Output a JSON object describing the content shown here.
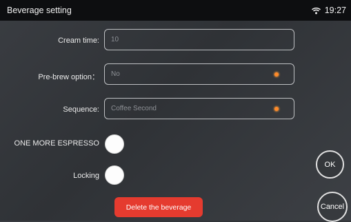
{
  "statusbar": {
    "title": "Beverage setting",
    "time": "19:27",
    "wifi_icon": "wifi-icon"
  },
  "form": {
    "cream_time": {
      "label": "Cream time:",
      "value": "10"
    },
    "prebrew": {
      "label": "Pre-brew option：",
      "value": "No",
      "indicator_color": "#ff8a2a"
    },
    "sequence": {
      "label": "Sequence:",
      "value": "Coffee Second",
      "indicator_color": "#ff8a2a"
    },
    "one_more_espresso": {
      "label": "ONE MORE ESPRESSO"
    },
    "locking": {
      "label": "Locking"
    }
  },
  "actions": {
    "delete_label": "Delete the beverage",
    "ok_label": "OK",
    "cancel_label": "Cancel"
  },
  "colors": {
    "accent": "#ff8a2a",
    "danger": "#e53b2f",
    "statusbar": "#0d0e10"
  }
}
